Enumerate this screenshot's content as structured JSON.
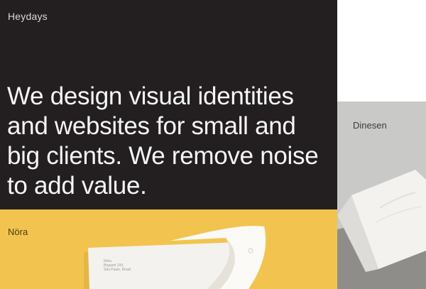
{
  "brand": {
    "name": "Heydays"
  },
  "hero": {
    "headline": "We design visual identities and websites for small and big clients. We remove noise to add value."
  },
  "projects": [
    {
      "title": "Nöra",
      "color": "#f2c44f",
      "address_lines": [
        "Nöra",
        "Bogaert 19/I,",
        "São Paulo, Brasil"
      ]
    },
    {
      "title": "Dinesen",
      "color": "#c9c9c8"
    }
  ],
  "colors": {
    "hero_background": "#231f20",
    "hero_text": "#f6f6f6",
    "page_background": "#ffffff"
  }
}
